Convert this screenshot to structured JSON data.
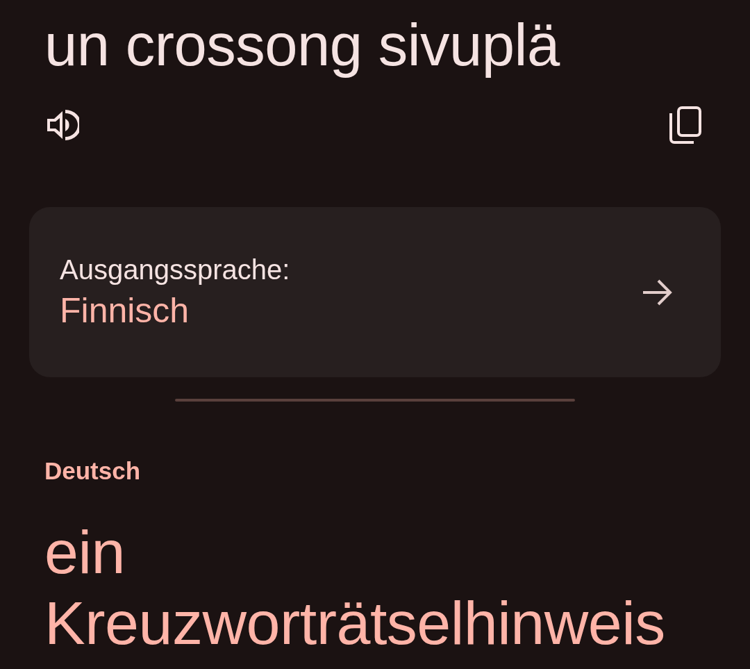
{
  "source": {
    "text": "un crossong sivuplä"
  },
  "detected_language": {
    "label": "Ausgangssprache:",
    "language": "Finnisch"
  },
  "translation": {
    "language": "Deutsch",
    "text": "ein Kreuzworträtselhinweis"
  }
}
